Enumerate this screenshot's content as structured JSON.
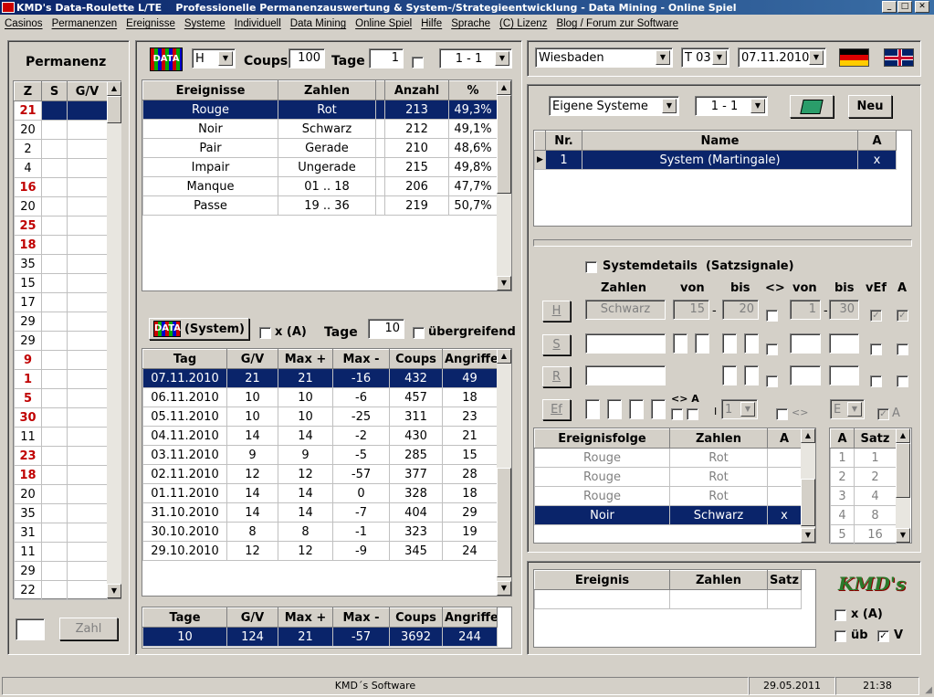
{
  "window": {
    "title": "KMD's Data-Roulette L/TE    Professionelle Permanenzauswertung & System-/Strategieentwicklung - Data Mining - Online Spiel"
  },
  "menu": [
    "Casinos",
    "Permanenzen",
    "Ereignisse",
    "Systeme",
    "Individuell",
    "Data Mining",
    "Online Spiel",
    "Hilfe",
    "Sprache",
    "(C) Lizenz",
    "Blog / Forum zur Software"
  ],
  "permanenz": {
    "title": "Permanenz",
    "headers": [
      "Z",
      "S",
      "G/V"
    ],
    "numbers": [
      {
        "z": "21",
        "red": true
      },
      {
        "z": "20",
        "red": false
      },
      {
        "z": "2",
        "red": false
      },
      {
        "z": "4",
        "red": false
      },
      {
        "z": "16",
        "red": true
      },
      {
        "z": "20",
        "red": false
      },
      {
        "z": "25",
        "red": true
      },
      {
        "z": "18",
        "red": true
      },
      {
        "z": "35",
        "red": false
      },
      {
        "z": "15",
        "red": false
      },
      {
        "z": "17",
        "red": false
      },
      {
        "z": "29",
        "red": false
      },
      {
        "z": "29",
        "red": false
      },
      {
        "z": "9",
        "red": true
      },
      {
        "z": "1",
        "red": true
      },
      {
        "z": "5",
        "red": true
      },
      {
        "z": "30",
        "red": true
      },
      {
        "z": "11",
        "red": false
      },
      {
        "z": "23",
        "red": true
      },
      {
        "z": "18",
        "red": true
      },
      {
        "z": "20",
        "red": false
      },
      {
        "z": "35",
        "red": false
      },
      {
        "z": "31",
        "red": false
      },
      {
        "z": "11",
        "red": false
      },
      {
        "z": "29",
        "red": false
      },
      {
        "z": "22",
        "red": false
      }
    ],
    "zahl_button": "Zahl"
  },
  "toolbar1": {
    "data_icon": "DATA",
    "combo_h": "H",
    "coups_label": "Coups",
    "coups_value": "100",
    "tage_label": "Tage",
    "tage_value": "1",
    "range_combo": "1 - 1"
  },
  "ereignisse": {
    "headers": [
      "Ereignisse",
      "Zahlen",
      "",
      "Anzahl",
      "%"
    ],
    "rows": [
      [
        "Rouge",
        "Rot",
        "",
        "213",
        "49,3%"
      ],
      [
        "Noir",
        "Schwarz",
        "",
        "212",
        "49,1%"
      ],
      [
        "Pair",
        "Gerade",
        "",
        "210",
        "48,6%"
      ],
      [
        "Impair",
        "Ungerade",
        "",
        "215",
        "49,8%"
      ],
      [
        "Manque",
        "01 .. 18",
        "",
        "206",
        "47,7%"
      ],
      [
        "Passe",
        "19 .. 36",
        "",
        "219",
        "50,7%"
      ]
    ]
  },
  "toolbar2": {
    "system_button": "(System)",
    "xa_label": "x (A)",
    "tage_label": "Tage",
    "tage_value": "10",
    "uebergreifend_label": "übergreifend"
  },
  "tage_table": {
    "headers": [
      "Tag",
      "G/V",
      "Max +",
      "Max -",
      "Coups",
      "Angriffe"
    ],
    "rows": [
      [
        "07.11.2010",
        "21",
        "21",
        "-16",
        "432",
        "49"
      ],
      [
        "06.11.2010",
        "10",
        "10",
        "-6",
        "457",
        "18"
      ],
      [
        "05.11.2010",
        "10",
        "10",
        "-25",
        "311",
        "23"
      ],
      [
        "04.11.2010",
        "14",
        "14",
        "-2",
        "430",
        "21"
      ],
      [
        "03.11.2010",
        "9",
        "9",
        "-5",
        "285",
        "15"
      ],
      [
        "02.11.2010",
        "12",
        "12",
        "-57",
        "377",
        "28"
      ],
      [
        "01.11.2010",
        "14",
        "14",
        "0",
        "328",
        "18"
      ],
      [
        "31.10.2010",
        "14",
        "14",
        "-7",
        "404",
        "29"
      ],
      [
        "30.10.2010",
        "8",
        "8",
        "-1",
        "323",
        "19"
      ],
      [
        "29.10.2010",
        "12",
        "12",
        "-9",
        "345",
        "24"
      ]
    ]
  },
  "summary": {
    "headers": [
      "Tage",
      "G/V",
      "Max +",
      "Max -",
      "Coups",
      "Angriffe"
    ],
    "values": [
      "10",
      "124",
      "21",
      "-57",
      "3692",
      "244"
    ]
  },
  "top_right": {
    "casino": "Wiesbaden",
    "table": "T 03",
    "date": "07.11.2010"
  },
  "systeme": {
    "combo": "Eigene Systeme",
    "range_combo": "1 - 1",
    "neu_button": "Neu",
    "headers": [
      "Nr.",
      "Name",
      "A"
    ],
    "rows": [
      [
        "1",
        "System (Martingale)",
        "x"
      ]
    ]
  },
  "systemdetails": {
    "checkbox_label": "Systemdetails  (Satzsignale)",
    "col_zahlen": "Zahlen",
    "col_von": "von",
    "col_bis": "bis",
    "col_ne": "<>",
    "col_von2": "von",
    "col_bis2": "bis",
    "col_vef": "vEf",
    "col_a": "A",
    "row_h": {
      "label": "H",
      "zahlen": "Schwarz",
      "von": "15",
      "bis": "20",
      "von2": "1",
      "bis2": "30"
    },
    "row_s": {
      "label": "S"
    },
    "row_r": {
      "label": "R"
    },
    "row_ef": {
      "label": "Ef",
      "ne_a": "<> A",
      "i_label": "I",
      "combo1": "1",
      "ne2": "<>",
      "combo_e": "E",
      "a_label": "A"
    }
  },
  "ereignisfolge": {
    "headers": [
      "Ereignisfolge",
      "Zahlen",
      "A"
    ],
    "rows": [
      [
        "Rouge",
        "Rot",
        ""
      ],
      [
        "Rouge",
        "Rot",
        ""
      ],
      [
        "Rouge",
        "Rot",
        ""
      ],
      [
        "Noir",
        "Schwarz",
        "x"
      ]
    ]
  },
  "satz": {
    "headers": [
      "A",
      "Satz"
    ],
    "rows": [
      [
        "1",
        "1"
      ],
      [
        "2",
        "2"
      ],
      [
        "3",
        "4"
      ],
      [
        "4",
        "8"
      ],
      [
        "5",
        "16"
      ]
    ]
  },
  "bottom_right": {
    "headers": [
      "Ereignis",
      "Zahlen",
      "Satz"
    ],
    "logo": "KMD's",
    "xa_label": "x (A)",
    "ueb_label": "üb",
    "v_label": "V"
  },
  "status": {
    "company": "KMD´s Software",
    "date": "29.05.2011",
    "time": "21:38"
  },
  "colors": {
    "selection": "#0a246a",
    "red_number": "#c00000",
    "window_bg": "#d4d0c8"
  }
}
